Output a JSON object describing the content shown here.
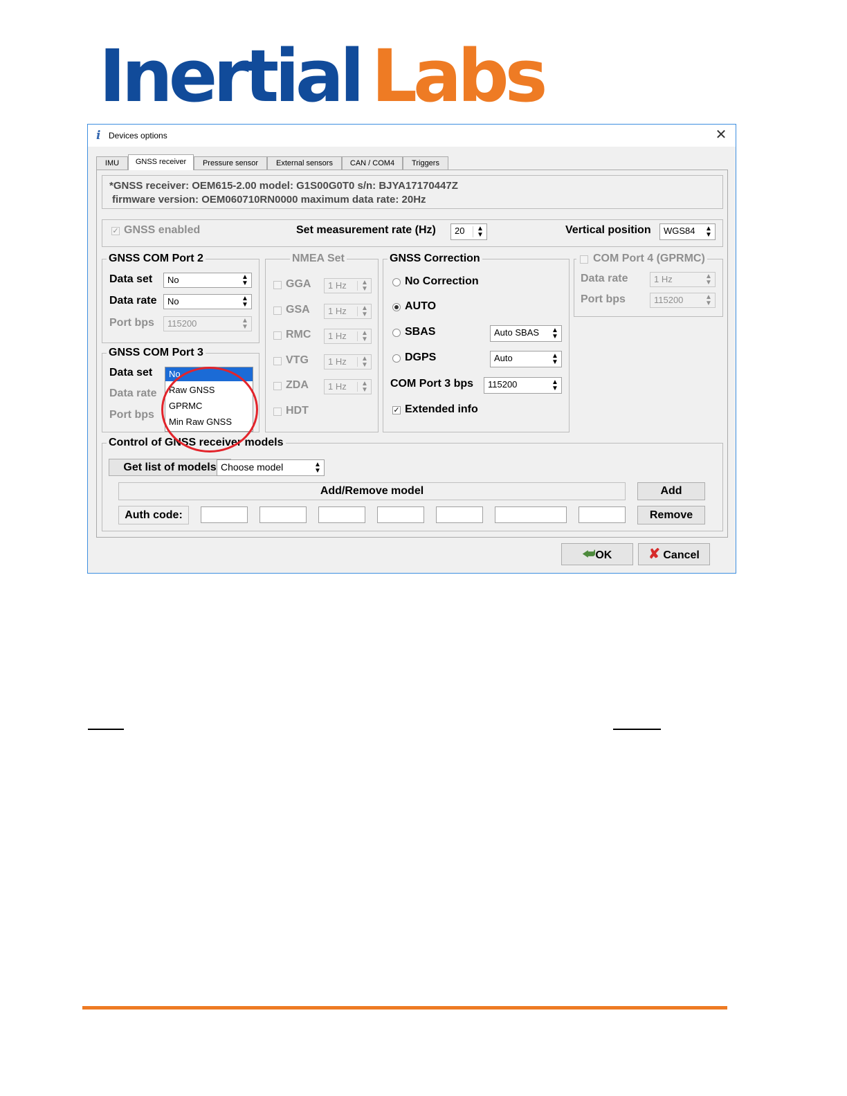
{
  "logo": {
    "part1": "Inertial",
    "part2": "Labs"
  },
  "window": {
    "title": "Devices options",
    "close_icon": "close-icon"
  },
  "tabs": [
    "IMU",
    "GNSS receiver",
    "Pressure sensor",
    "External sensors",
    "CAN / COM4",
    "Triggers"
  ],
  "active_tab": "GNSS receiver",
  "info": {
    "line1": "*GNSS receiver: OEM615-2.00 model: G1S00G0T0 s/n: BJYA17170447Z",
    "line2": "firmware version: OEM060710RN0000 maximum data rate: 20Hz"
  },
  "top_row": {
    "gnss_enabled_label": "GNSS enabled",
    "gnss_enabled_checked": true,
    "rate_label": "Set measurement rate (Hz)",
    "rate_value": "20",
    "vertical_label": "Vertical position",
    "vertical_value": "WGS84"
  },
  "port2": {
    "title": "GNSS COM Port 2",
    "data_set_label": "Data set",
    "data_set_value": "No",
    "data_rate_label": "Data rate",
    "data_rate_value": "No",
    "port_bps_label": "Port bps",
    "port_bps_value": "115200"
  },
  "port3": {
    "title": "GNSS COM Port 3",
    "data_set_label": "Data set",
    "data_rate_label": "Data rate",
    "port_bps_label": "Port bps",
    "dropdown_selected": "No",
    "dropdown_options": [
      "Raw GNSS",
      "GPRMC",
      "Min Raw GNSS"
    ]
  },
  "nmea": {
    "title": "NMEA Set",
    "items": [
      {
        "name": "GGA",
        "rate": "1 Hz"
      },
      {
        "name": "GSA",
        "rate": "1 Hz"
      },
      {
        "name": "RMC",
        "rate": "1 Hz"
      },
      {
        "name": "VTG",
        "rate": "1 Hz"
      },
      {
        "name": "ZDA",
        "rate": "1 Hz"
      },
      {
        "name": "HDT",
        "rate": ""
      }
    ]
  },
  "correction": {
    "title": "GNSS Correction",
    "no_correction": "No Correction",
    "auto": "AUTO",
    "sbas": "SBAS",
    "sbas_value": "Auto SBAS",
    "dgps": "DGPS",
    "dgps_value": "Auto",
    "selected": "AUTO",
    "com3_label": "COM Port 3 bps",
    "com3_value": "115200",
    "extended_label": "Extended info",
    "extended_checked": true
  },
  "com4": {
    "title": "COM Port 4 (GPRMC)",
    "data_rate_label": "Data rate",
    "data_rate_value": "1 Hz",
    "port_bps_label": "Port bps",
    "port_bps_value": "115200"
  },
  "models": {
    "title": "Control of GNSS receiver models",
    "get_list": "Get list of models",
    "choose": "Choose model",
    "add_remove": "Add/Remove model",
    "add": "Add",
    "auth_label": "Auth code:",
    "remove": "Remove"
  },
  "buttons": {
    "ok": "OK",
    "cancel": "Cancel"
  },
  "colors": {
    "logo_blue": "#114b9a",
    "logo_orange": "#ee7b24",
    "highlight_circle": "#e3242b",
    "selection": "#1b6bd6"
  }
}
